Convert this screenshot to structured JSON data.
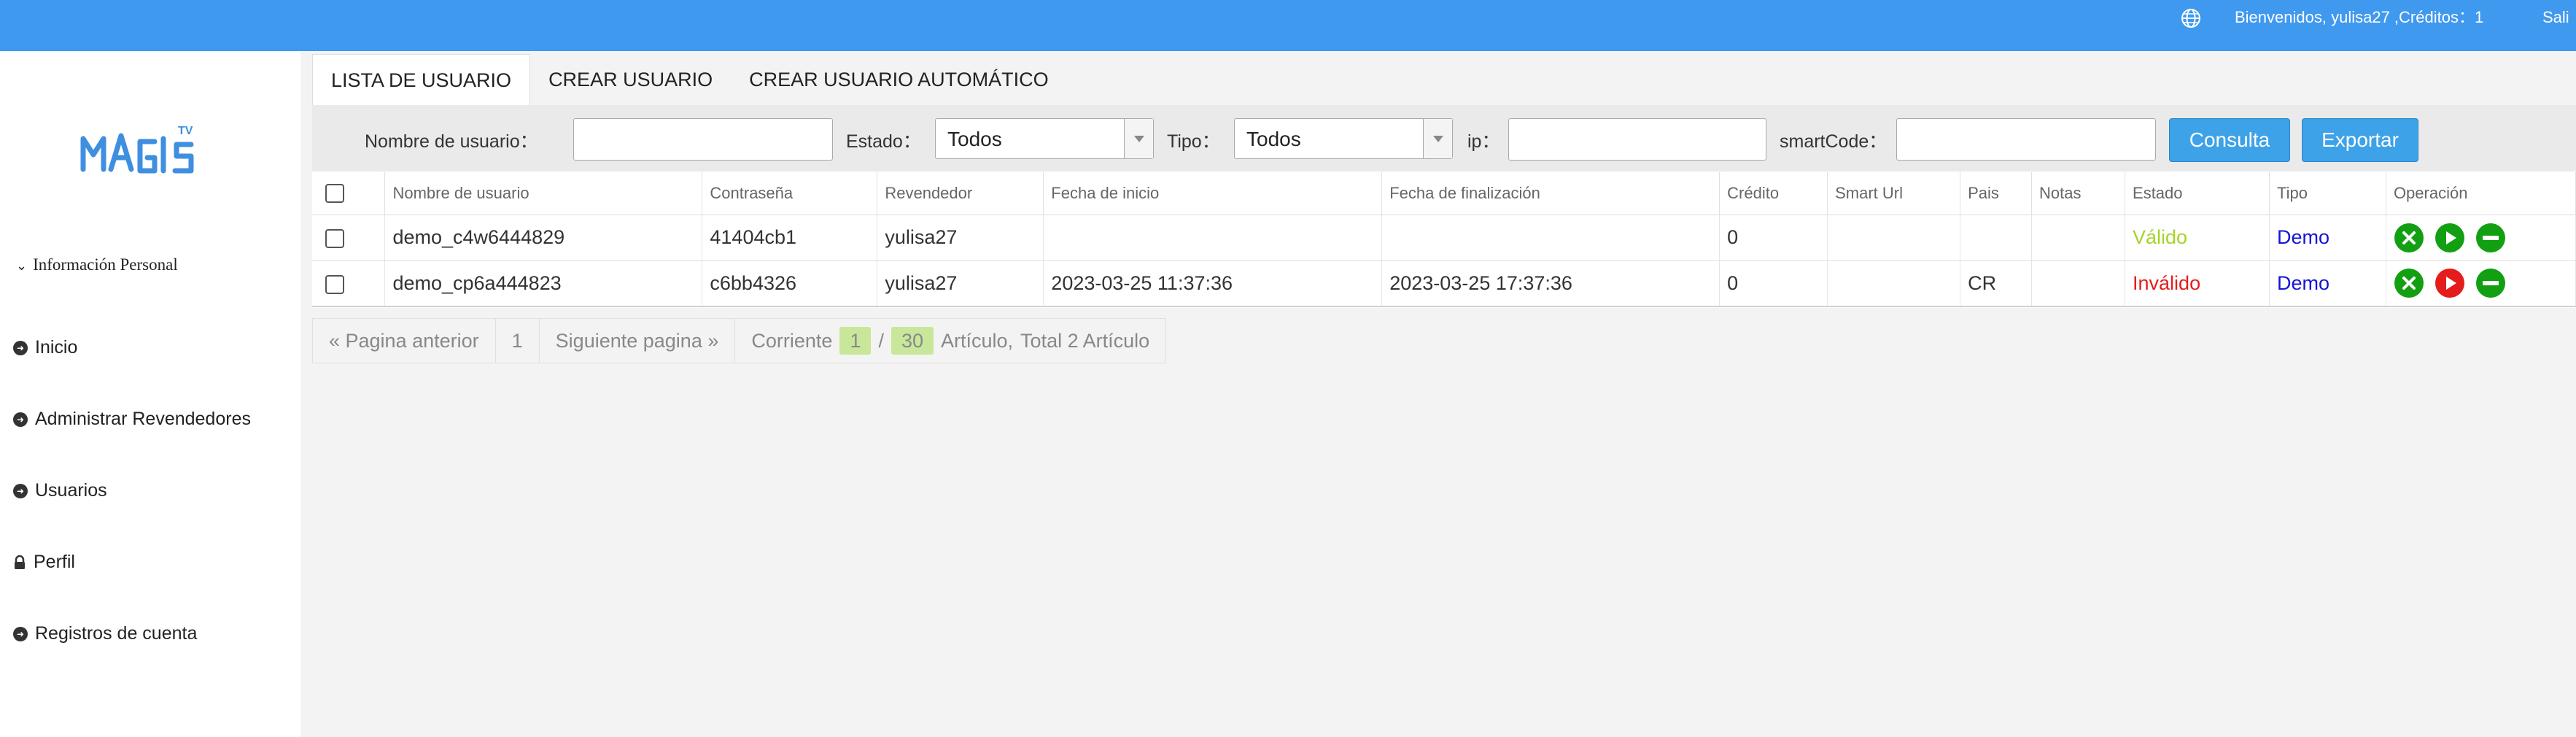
{
  "topbar": {
    "globe_icon": "globe-icon",
    "welcome": "Bienvenidos, yulisa27 ,Créditos：1",
    "logout": "Sali"
  },
  "sidebar": {
    "logo_icon": "magis-tv-logo",
    "section_title": "Información Personal",
    "items": [
      {
        "label": "Inicio",
        "icon": "arrow-circle-icon"
      },
      {
        "label": "Administrar Revendedores",
        "icon": "arrow-circle-icon"
      },
      {
        "label": "Usuarios",
        "icon": "arrow-circle-icon"
      },
      {
        "label": "Perfil",
        "icon": "lock-icon"
      },
      {
        "label": "Registros de cuenta",
        "icon": "arrow-circle-icon"
      }
    ]
  },
  "tabs": [
    {
      "label": "LISTA DE USUARIO",
      "active": true
    },
    {
      "label": "CREAR USUARIO",
      "active": false
    },
    {
      "label": "CREAR USUARIO AUTOMÁTICO",
      "active": false
    }
  ],
  "filters": {
    "username_label": "Nombre de usuario：",
    "username_value": "",
    "estado_label": "Estado：",
    "estado_value": "Todos",
    "tipo_label": "Tipo：",
    "tipo_value": "Todos",
    "ip_label": "ip：",
    "ip_value": "",
    "smartcode_label": "smartCode：",
    "smartcode_value": "",
    "consulta_label": "Consulta",
    "exportar_label": "Exportar"
  },
  "table": {
    "columns": [
      "Nombre de usuario",
      "Contraseña",
      "Revendedor",
      "Fecha de inicio",
      "Fecha de finalización",
      "Crédito",
      "Smart Url",
      "Pais",
      "Notas",
      "Estado",
      "Tipo",
      "Operación"
    ],
    "rows": [
      {
        "username": "demo_c4w6444829",
        "password": "41404cb1",
        "reseller": "yulisa27",
        "start": "",
        "end": "",
        "credit": "0",
        "smart_url": "",
        "country": "",
        "notes": "",
        "status": "Válido",
        "status_class": "valid",
        "type": "Demo",
        "play_color": "#12a012"
      },
      {
        "username": "demo_cp6a444823",
        "password": "c6bb4326",
        "reseller": "yulisa27",
        "start": "2023-03-25 11:37:36",
        "end": "2023-03-25 17:37:36",
        "credit": "0",
        "smart_url": "",
        "country": "CR",
        "notes": "",
        "status": "Inválido",
        "status_class": "invalid",
        "type": "Demo",
        "play_color": "#e41c1c"
      }
    ]
  },
  "pager": {
    "prev": "« Pagina anterior",
    "page": "1",
    "next": "Siguiente pagina »",
    "current_label": "Corriente",
    "current_page": "1",
    "sep": "/",
    "per_page": "30",
    "articulo": "Artículo,",
    "total": "Total 2 Artículo"
  },
  "colors": {
    "topbar": "#3f99ef",
    "button": "#3da2e8",
    "valid": "#a6d32a",
    "invalid": "#e41c1c",
    "type": "#1414d8",
    "op_green": "#12a012"
  }
}
